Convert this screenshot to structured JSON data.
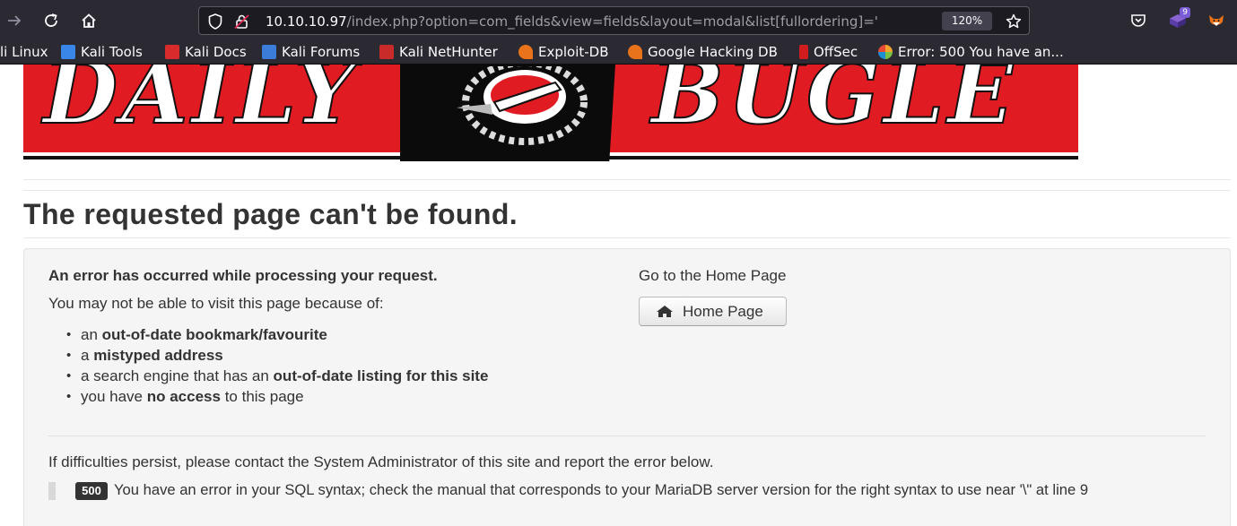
{
  "browser": {
    "url_host": "10.10.10.97",
    "url_path": "/index.php?option=com_fields&view=fields&layout=modal&list[fullordering]='",
    "zoom": "120%",
    "extension_badge": "9",
    "bookmarks": [
      {
        "label": "li Linux",
        "color": "#2f6fd1"
      },
      {
        "label": "Kali Tools",
        "color": "#3a86e8"
      },
      {
        "label": "Kali Docs",
        "color": "#d92b2b"
      },
      {
        "label": "Kali Forums",
        "color": "#3b7dd8"
      },
      {
        "label": "Kali NetHunter",
        "color": "#c92a2a"
      },
      {
        "label": "Exploit-DB",
        "color": "#e8731a"
      },
      {
        "label": "Google Hacking DB",
        "color": "#e8731a"
      },
      {
        "label": "OffSec",
        "color": "#d11d1d"
      },
      {
        "label": "Error: 500 You have an...",
        "color": "#f4a32c"
      }
    ]
  },
  "banner": {
    "word_left": "DAILY",
    "word_right": "BUGLE"
  },
  "page": {
    "title": "The requested page can't be found.",
    "error_heading": "An error has occurred while processing your request.",
    "error_sub": "You may not be able to visit this page because of:",
    "reasons": [
      {
        "pre": "an ",
        "bold": "out-of-date bookmark/favourite",
        "post": ""
      },
      {
        "pre": "a ",
        "bold": "mistyped address",
        "post": ""
      },
      {
        "pre": "a search engine that has an ",
        "bold": "out-of-date listing for this site",
        "post": ""
      },
      {
        "pre": "you have ",
        "bold": "no access",
        "post": " to this page"
      }
    ],
    "goto_label": "Go to the Home Page",
    "home_button": "Home Page",
    "persist_text": "If difficulties persist, please contact the System Administrator of this site and report the error below.",
    "error_code": "500",
    "error_message": "You have an error in your SQL syntax; check the manual that corresponds to your MariaDB server version for the right syntax to use near '\\\" at line 9"
  },
  "colors": {
    "banner_red": "#e11b22",
    "chrome_bg": "#2b2a33",
    "urlbar_bg": "#1c1b22",
    "text": "#333333"
  }
}
